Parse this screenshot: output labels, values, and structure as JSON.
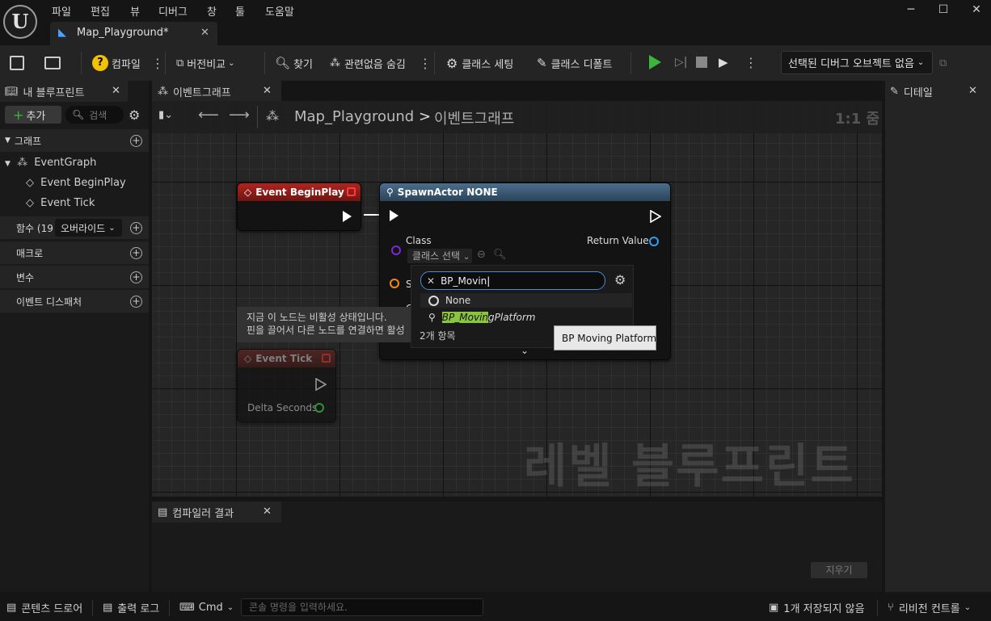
{
  "menu": [
    "파일",
    "편집",
    "뷰",
    "디버그",
    "창",
    "툴",
    "도움말"
  ],
  "doc_tab": {
    "label": "Map_Playground*"
  },
  "toolbar": {
    "compile": "컴파일",
    "diff": "버전비교",
    "find": "찾기",
    "hide_unrelated": "관련없음 숨김",
    "class_settings": "클래스 세팅",
    "class_defaults": "클래스 디폴트",
    "debug_object": "선택된 디버그 오브젝트 없음"
  },
  "left_panel": {
    "tab": "내 블루프린트",
    "add": "추가",
    "search_placeholder": "검색",
    "graphs": "그래프",
    "event_graph": "EventGraph",
    "events": [
      "Event BeginPlay",
      "Event Tick"
    ],
    "functions": "함수 (19 오",
    "override": "오버라이드",
    "macros": "매크로",
    "variables": "변수",
    "dispatchers": "이벤트 디스패처"
  },
  "graph_tab": {
    "label": "이벤트그래프"
  },
  "graph_bar": {
    "crumb_root": "Map_Playground",
    "crumb_sep": ">",
    "crumb_leaf": "이벤트그래프",
    "zoom": "1:1 줌"
  },
  "watermark": "레벨 블루프린트",
  "nodes": {
    "begin_play": {
      "title": "Event BeginPlay"
    },
    "spawn": {
      "title": "SpawnActor NONE",
      "class_label": "Class",
      "return_label": "Return Value",
      "class_select": "클래스 선택",
      "pin_s": "S",
      "pin_c": "C"
    },
    "tick": {
      "title": "Event Tick",
      "delta": "Delta Seconds"
    }
  },
  "tooltip_disabled": {
    "line1": "지금 이 노드는 비활성 상태입니다.",
    "line2": "핀을 끌어서 다른 노드를 연결하면 활성"
  },
  "picker": {
    "search_value": "BP_Movin",
    "options": [
      {
        "label": "None"
      },
      {
        "label": "BP_MovingPlatform",
        "highlight": "BP_Movin",
        "rest": "gPlatform"
      }
    ],
    "count": "2개 항목",
    "hover_tooltip": "BP Moving Platform"
  },
  "compiler": {
    "tab": "컴파일러 결과",
    "clear": "지우기"
  },
  "details": {
    "tab": "디테일"
  },
  "status": {
    "content_drawer": "콘텐츠 드로어",
    "output_log": "출력 로그",
    "cmd": "Cmd",
    "console_placeholder": "콘솔 명령을 입력하세요.",
    "unsaved": "1개 저장되지 않음",
    "revision": "리비전 컨트롤"
  },
  "colors": {
    "event_red": "#a0201c",
    "spawn_blue": "#3b5f7c",
    "accent_green": "#3cb53c",
    "highlight": "#8bc53f"
  }
}
